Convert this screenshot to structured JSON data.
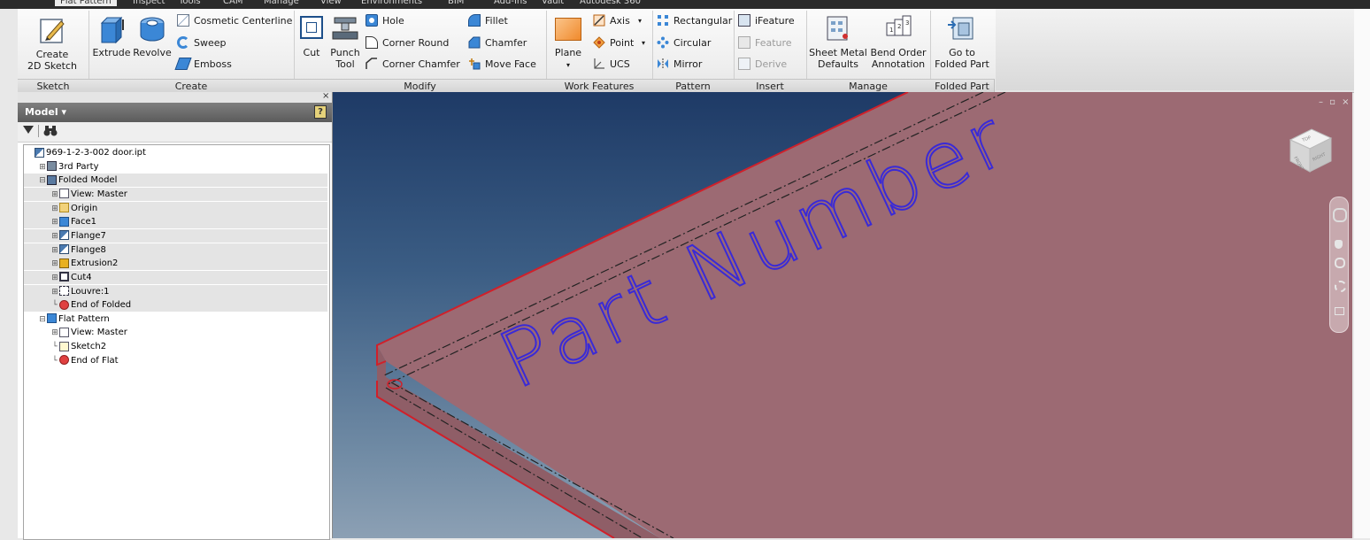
{
  "tabs": [
    "Flat Pattern",
    "Inspect",
    "Tools",
    "CAM",
    "Manage",
    "View",
    "Environments",
    "BIM",
    "Add-Ins",
    "Vault",
    "Autodesk 360"
  ],
  "ribbon": {
    "sketch": {
      "create_2d_sketch": "Create\n2D Sketch"
    },
    "create": {
      "extrude": "Extrude",
      "revolve": "Revolve",
      "cosmetic_centerline": "Cosmetic Centerline",
      "sweep": "Sweep",
      "emboss": "Emboss"
    },
    "modify": {
      "cut": "Cut",
      "punch_tool": "Punch\nTool",
      "hole": "Hole",
      "corner_round": "Corner Round",
      "corner_chamfer": "Corner Chamfer",
      "fillet": "Fillet",
      "chamfer": "Chamfer",
      "move_face": "Move Face"
    },
    "work_features": {
      "plane": "Plane",
      "axis": "Axis",
      "point": "Point",
      "ucs": "UCS"
    },
    "pattern": {
      "rectangular": "Rectangular",
      "circular": "Circular",
      "mirror": "Mirror"
    },
    "insert": {
      "ifeature": "iFeature",
      "feature": "Feature",
      "derive": "Derive"
    },
    "manage": {
      "sheet_metal_defaults": "Sheet Metal\nDefaults",
      "bend_order_annotation": "Bend Order\nAnnotation"
    },
    "folded_part": {
      "go_to_folded_part": "Go to\nFolded Part"
    },
    "panels": [
      "Sketch",
      "Create",
      "Modify",
      "Work Features",
      "Pattern",
      "Insert",
      "Manage",
      "Folded Part"
    ]
  },
  "browser": {
    "title": "Model ▾",
    "help": "?",
    "close": "×",
    "tree": [
      {
        "label": "969-1-2-3-002 door.ipt",
        "icon": "part-icon",
        "level": 0,
        "expander": "",
        "highlight": false
      },
      {
        "label": "3rd Party",
        "icon": "third-party-icon",
        "level": 1,
        "expander": "+",
        "highlight": false
      },
      {
        "label": "Folded Model",
        "icon": "folded-model-icon",
        "level": 1,
        "expander": "−",
        "highlight": true
      },
      {
        "label": "View: Master",
        "icon": "view-icon",
        "level": 2,
        "expander": "+",
        "highlight": true
      },
      {
        "label": "Origin",
        "icon": "folder-icon",
        "level": 2,
        "expander": "+",
        "highlight": true
      },
      {
        "label": "Face1",
        "icon": "face-icon",
        "level": 2,
        "expander": "+",
        "highlight": true
      },
      {
        "label": "Flange7",
        "icon": "flange-icon",
        "level": 2,
        "expander": "+",
        "highlight": true
      },
      {
        "label": "Flange8",
        "icon": "flange-icon",
        "level": 2,
        "expander": "+",
        "highlight": true
      },
      {
        "label": "Extrusion2",
        "icon": "extrusion-icon",
        "level": 2,
        "expander": "+",
        "highlight": true
      },
      {
        "label": "Cut4",
        "icon": "cut-icon",
        "level": 2,
        "expander": "+",
        "highlight": true
      },
      {
        "label": "Louvre:1",
        "icon": "louvre-icon",
        "level": 2,
        "expander": "+",
        "highlight": true
      },
      {
        "label": "End of Folded",
        "icon": "end-of-part-icon",
        "level": 2,
        "expander": "",
        "highlight": true
      },
      {
        "label": "Flat Pattern",
        "icon": "flat-pattern-icon",
        "level": 1,
        "expander": "−",
        "highlight": false
      },
      {
        "label": "View: Master",
        "icon": "view-icon",
        "level": 2,
        "expander": "+",
        "highlight": false
      },
      {
        "label": "Sketch2",
        "icon": "sketch-icon",
        "level": 2,
        "expander": "",
        "highlight": false
      },
      {
        "label": "End of Flat",
        "icon": "end-of-part-icon",
        "level": 2,
        "expander": "",
        "highlight": false
      }
    ]
  },
  "viewport": {
    "sketch_text": "Part Number",
    "part_color": "#9c6a73",
    "edge_color": "#d0202a",
    "text_color": "#3a2ad6",
    "viewcube_faces": [
      "FRONT",
      "RIGHT",
      "TOP"
    ],
    "window_controls": "– ▫ ×"
  }
}
